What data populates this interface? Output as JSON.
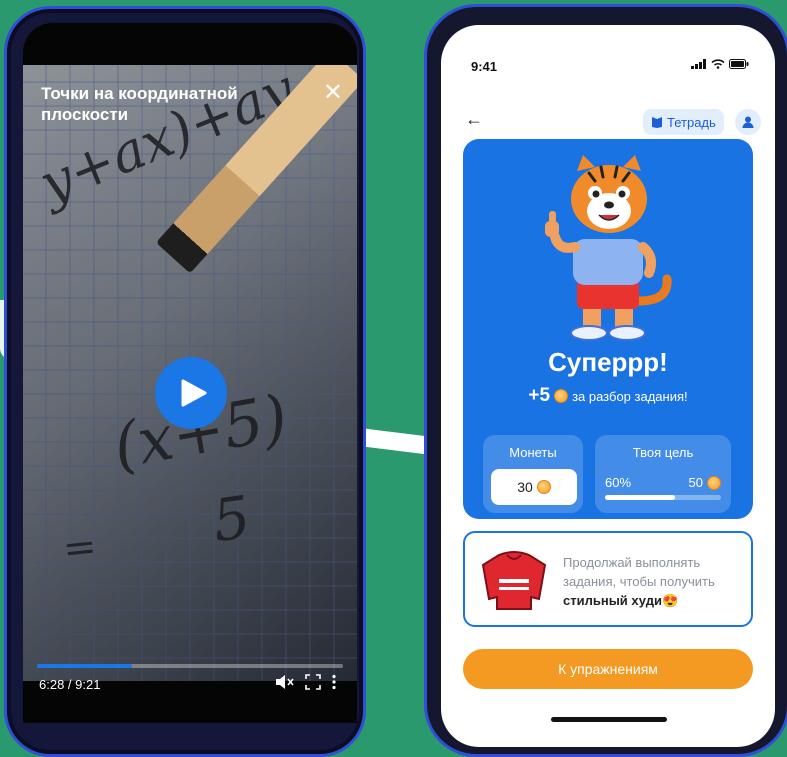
{
  "video_player": {
    "title": "Точки на координатной плоскости",
    "time": "6:28 / 9:21",
    "progress": 0.31,
    "icons": [
      "close-icon",
      "play-icon",
      "volume-mute-icon",
      "fullscreen-icon",
      "more-vertical-icon"
    ]
  },
  "lesson_screen": {
    "status_time": "9:41",
    "notebook_label": "Тетрадь",
    "headline": "Суперрр!",
    "reward": {
      "amount": "+5",
      "text": "за разбор задания!"
    },
    "coins_panel": {
      "title": "Монеты",
      "value": "30"
    },
    "goal_panel": {
      "title": "Твоя цель",
      "percent_label": "60%",
      "target": "50",
      "progress": 0.6
    },
    "promo": {
      "text": "Продолжай выполнять задания, чтобы получить",
      "strong": "стильный худи"
    },
    "cta_label": "К упражнениям",
    "colors": {
      "primary_blue": "#1a73e2",
      "cta_orange": "#f49a22",
      "background_green": "#2a9a6e"
    }
  }
}
